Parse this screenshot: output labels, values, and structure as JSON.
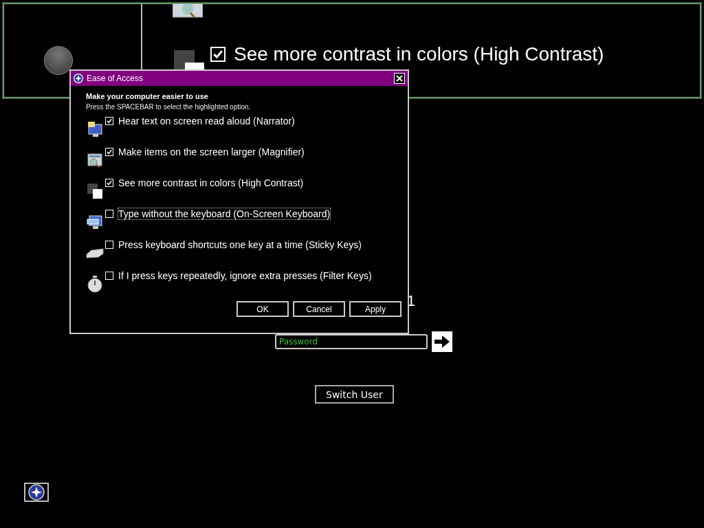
{
  "magnifier": {
    "option": {
      "label": "See more contrast in colors (High Contrast)",
      "checked": true
    }
  },
  "login": {
    "user_name": "1",
    "password": {
      "placeholder": "Password"
    },
    "switch_user": "Switch User"
  },
  "dialog": {
    "title": "Ease of Access",
    "heading": "Make your computer easier to use",
    "instruction": "Press the SPACEBAR to select the highlighted option.",
    "options": [
      {
        "kind": "narrator",
        "label": "Hear text on screen read aloud (Narrator)",
        "checked": true,
        "focused": false
      },
      {
        "kind": "magnifier",
        "label": "Make items on the screen larger (Magnifier)",
        "checked": true,
        "focused": false
      },
      {
        "kind": "contrast",
        "label": "See more contrast in colors (High Contrast)",
        "checked": true,
        "focused": false
      },
      {
        "kind": "keyboard",
        "label": "Type without the keyboard (On-Screen Keyboard)",
        "checked": false,
        "focused": true
      },
      {
        "kind": "sticky",
        "label": "Press keyboard shortcuts one key at a time (Sticky Keys)",
        "checked": false,
        "focused": false
      },
      {
        "kind": "filter",
        "label": "If I press keys repeatedly, ignore extra presses (Filter Keys)",
        "checked": false,
        "focused": false
      }
    ],
    "buttons": [
      "OK",
      "Cancel",
      "Apply"
    ]
  }
}
